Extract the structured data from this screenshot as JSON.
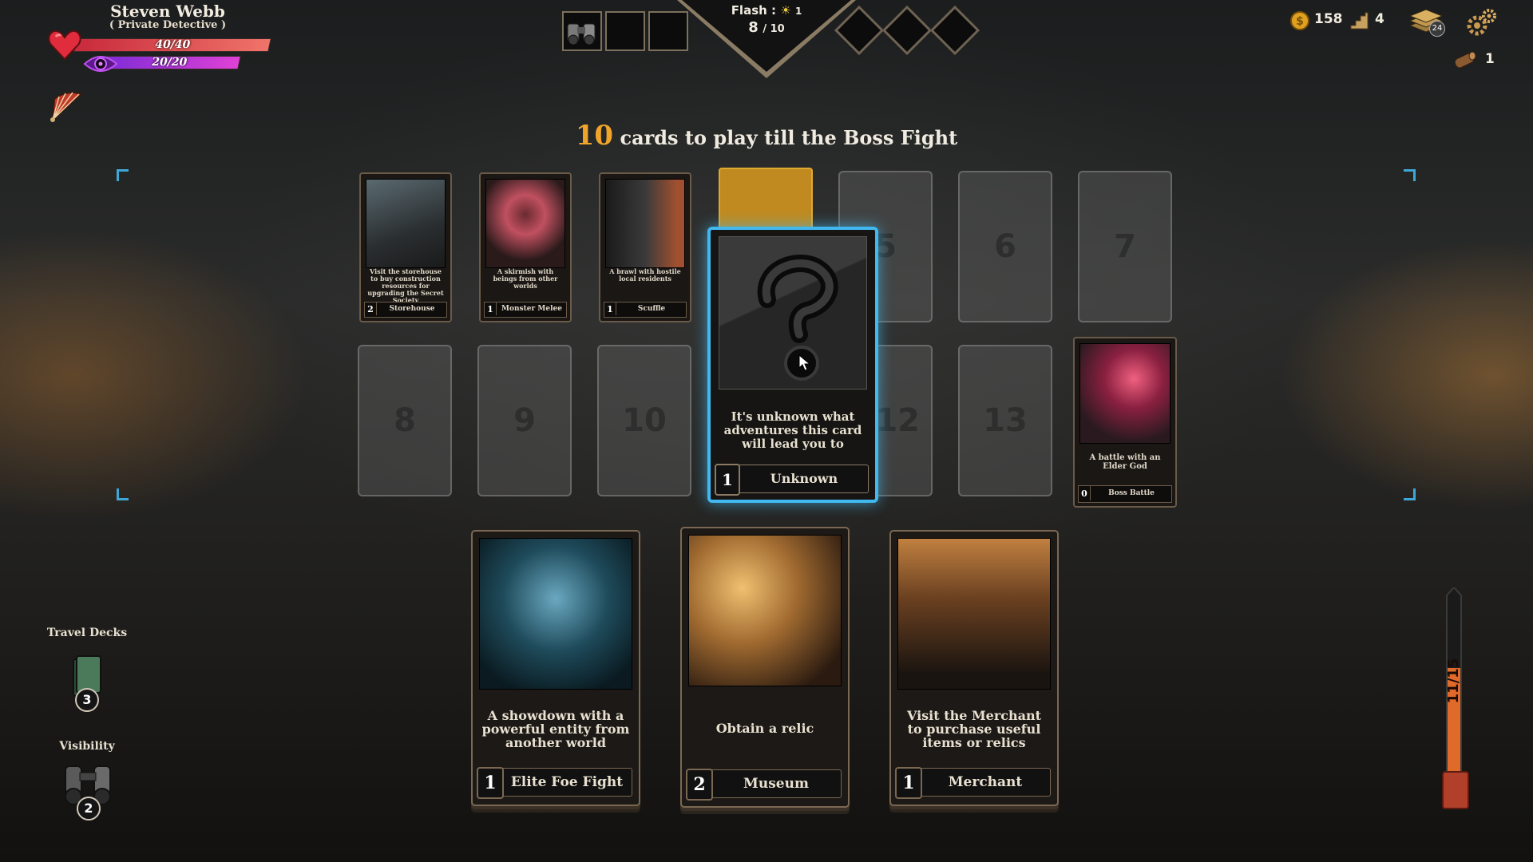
{
  "player": {
    "name": "Steven Webb",
    "role": "( Private Detective )",
    "health_text": "40/40",
    "health_fraction": 1.0,
    "health_color": "#e0394a",
    "sanity_text": "20/20",
    "sanity_fraction": 1.0,
    "sanity_color": "#b03ee0"
  },
  "top_center": {
    "inventory_slots": [
      "binoculars-icon",
      "",
      ""
    ],
    "flash_label": "Flash :",
    "flash_bonus": "1",
    "flash_value": "8",
    "flash_max": "/ 10",
    "diamond_slots": 3
  },
  "resources": {
    "gold": "158",
    "stairs": "4",
    "deck_count": "24",
    "wood": "1"
  },
  "header": {
    "count": "10",
    "text": "cards to play till the Boss Fight"
  },
  "track": {
    "played": [
      {
        "desc": "Visit the storehouse to buy construction resources for upgrading the Secret Society",
        "cost": "2",
        "name": "Storehouse"
      },
      {
        "desc": "A skirmish with beings from other worlds",
        "cost": "1",
        "name": "Monster Melee"
      },
      {
        "desc": "A brawl with hostile local residents",
        "cost": "1",
        "name": "Scuffle"
      }
    ],
    "empty_slots": [
      "5",
      "6",
      "7",
      "8",
      "9",
      "10",
      "12",
      "13"
    ],
    "boss": {
      "desc": "A battle with an Elder God",
      "cost": "0",
      "name": "Boss Battle"
    }
  },
  "selected_card": {
    "desc": "It's unknown what adventures this card will lead you to",
    "cost": "1",
    "name": "Unknown"
  },
  "hand": [
    {
      "desc": "A showdown with a powerful entity from another world",
      "cost": "1",
      "name": "Elite Foe Fight"
    },
    {
      "desc": "Obtain a relic",
      "cost": "2",
      "name": "Museum"
    },
    {
      "desc": "Visit the Merchant to purchase useful items or relics",
      "cost": "1",
      "name": "Merchant"
    }
  ],
  "sidebar": {
    "travel_decks_label": "Travel Decks",
    "travel_decks_count": "3",
    "visibility_label": "Visibility",
    "visibility_count": "2"
  },
  "gauge": {
    "text": "11/15",
    "fraction": 0.7333,
    "color": "#e06a2a"
  },
  "colors": {
    "accent_gold": "#f0a52a",
    "selection_blue": "#41b8f0"
  }
}
